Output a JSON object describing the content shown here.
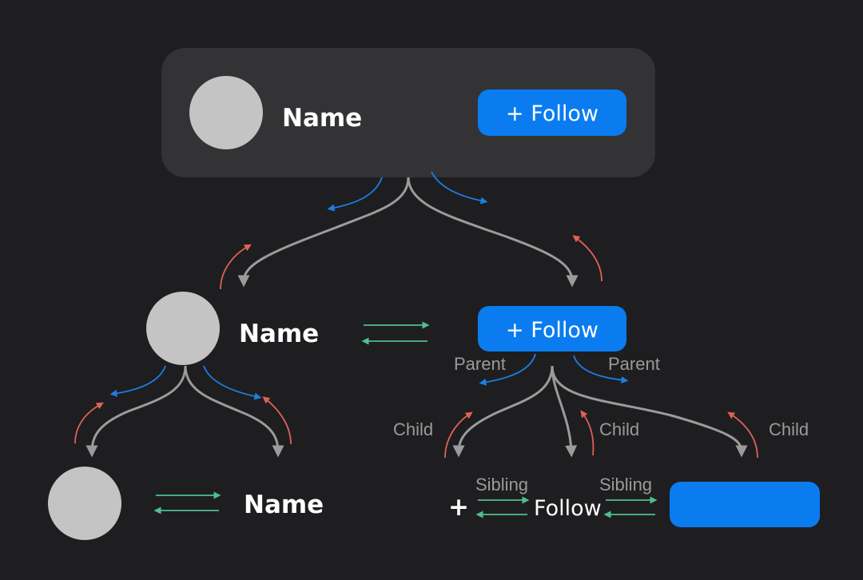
{
  "card": {
    "name": "Name",
    "button_label": "+ Follow"
  },
  "level2": {
    "name": "Name",
    "button_label": "+ Follow"
  },
  "level3": {
    "name": "Name",
    "plus": "+",
    "follow": "Follow"
  },
  "labels": {
    "parent": "Parent",
    "child": "Child",
    "sibling": "Sibling"
  },
  "colors": {
    "background": "#1e1e20",
    "card": "#333335",
    "accent": "#0a7cf0",
    "avatar": "#c4c4c4",
    "parent_arrow": "#1a7fe6",
    "child_arrow": "#e0605a",
    "sibling_arrow": "#4fbf8f",
    "tree_line": "#9b9b9b"
  }
}
